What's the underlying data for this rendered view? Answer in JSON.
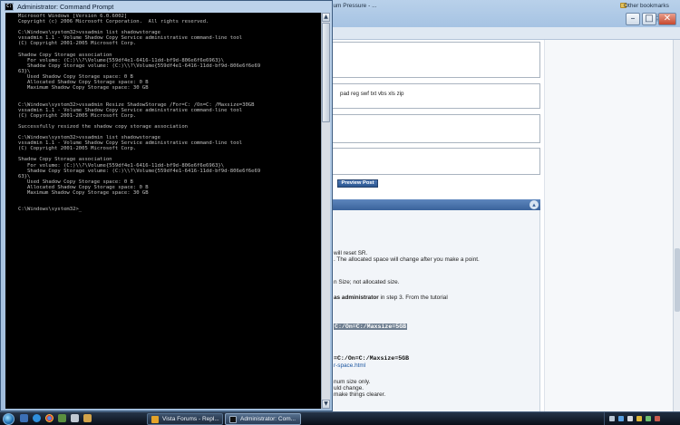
{
  "browser": {
    "bookmark_tab": "ium Pressure - ...",
    "other_bookmarks": "Other bookmarks",
    "extensions_line": "pad reg swf txt vbs xls zip",
    "preview_button": "Preview Post",
    "post": {
      "l1": "will reset SR.",
      "l2": ". The allocated space will change after you make a point.",
      "l3": "n Size; not allocated size.",
      "l4_bold": "as administrator",
      "l4_rest": " in step 3. From the tutorial",
      "code1": "C:/On=C:/Maxsize=5GB",
      "code2": "=C:/On=C:/Maxsize=5GB",
      "link": "r-space.html",
      "l5": "num size only.",
      "l6": "uld change.",
      "l7": "make things clearer."
    }
  },
  "cmd": {
    "title": "Administrator: Command Prompt",
    "output": "Microsoft Windows [Version 6.0.6002]\nCopyright (c) 2006 Microsoft Corporation.  All rights reserved.\n\nC:\\Windows\\system32>vssadmin list shadowstorage\nvssadmin 1.1 - Volume Shadow Copy Service administrative command-line tool\n(C) Copyright 2001-2005 Microsoft Corp.\n\nShadow Copy Storage association\n   For volume: (C:)\\\\?\\Volume{559df4e1-6416-11dd-bf9d-806e6f6e6963}\\\n   Shadow Copy Storage volume: (C:)\\\\?\\Volume{559df4e1-6416-11dd-bf9d-806e6f6e69\n63}\\\n   Used Shadow Copy Storage space: 0 B\n   Allocated Shadow Copy Storage space: 0 B\n   Maximum Shadow Copy Storage space: 30 GB\n\n\nC:\\Windows\\system32>vssadmin Resize ShadowStorage /For=C: /On=C: /Maxsize=30GB\nvssadmin 1.1 - Volume Shadow Copy Service administrative command-line tool\n(C) Copyright 2001-2005 Microsoft Corp.\n\nSuccessfully resized the shadow copy storage association\n\nC:\\Windows\\system32>vssadmin list shadowstorage\nvssadmin 1.1 - Volume Shadow Copy Service administrative command-line tool\n(C) Copyright 2001-2005 Microsoft Corp.\n\nShadow Copy Storage association\n   For volume: (C:)\\\\?\\Volume{559df4e1-6416-11dd-bf9d-806e6f6e6963}\\\n   Shadow Copy Storage volume: (C:)\\\\?\\Volume{559df4e1-6416-11dd-bf9d-806e6f6e69\n63}\\\n   Used Shadow Copy Storage space: 0 B\n   Allocated Shadow Copy Storage space: 0 B\n   Maximum Shadow Copy Storage space: 30 GB\n\n\nC:\\Windows\\system32>_"
  },
  "taskbar": {
    "buttons": [
      {
        "label": "Vista Forums - Repl...",
        "icon_color": "#e4a329"
      },
      {
        "label": "Administrator: Com...",
        "icon_color": "#101010"
      }
    ]
  },
  "colors": {
    "console_bg": "#000000",
    "console_text": "#c0c0c0",
    "title_bar": "#a6c3e3",
    "taskbar": "#0a0f18",
    "forum_header": "#3a629b",
    "link": "#1a55a0"
  },
  "icons": [
    "command-prompt-icon",
    "start-orb-icon",
    "folder-icon",
    "star-icon",
    "page-icon",
    "wrench-icon",
    "scroll-up-arrow-icon",
    "scroll-down-arrow-icon",
    "chrome-icon"
  ]
}
